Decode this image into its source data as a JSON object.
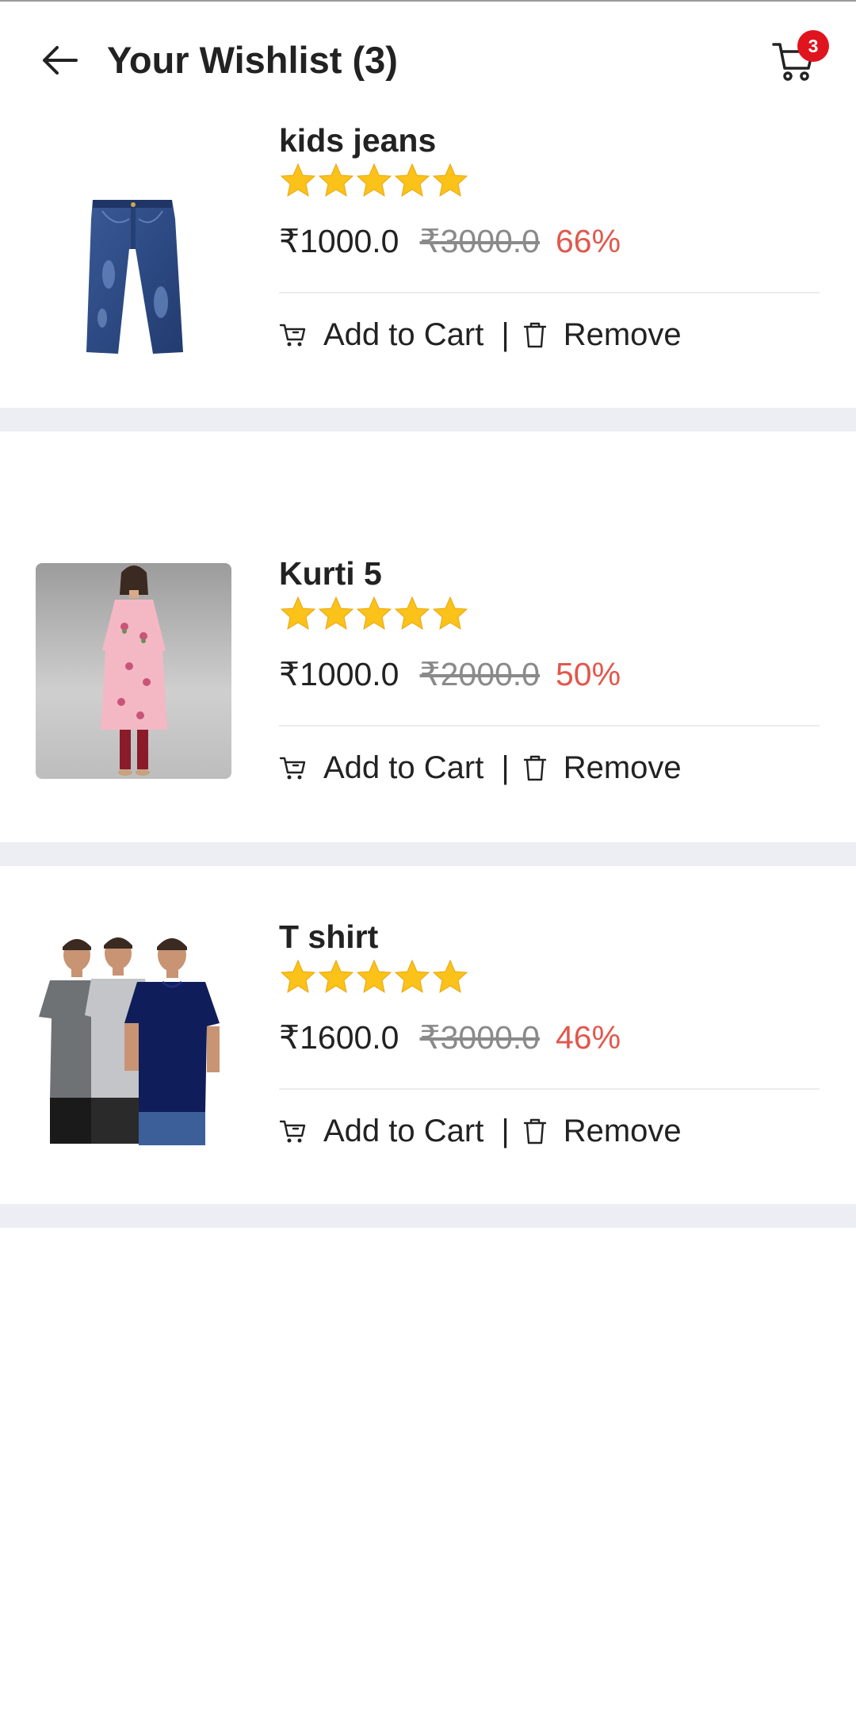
{
  "header": {
    "title": "Your Wishlist (3)",
    "back_icon": "arrow-left-icon",
    "cart_icon": "cart-icon",
    "cart_count": "3"
  },
  "colors": {
    "badge": "#e0141e",
    "discount": "#e2574c",
    "star": "#fbc21a",
    "divider": "#eceef3"
  },
  "items": [
    {
      "name": "kids jeans",
      "rating": 5,
      "price": "₹1000.0",
      "mrp": "₹3000.0",
      "discount": "66%",
      "add_to_cart": "Add to Cart",
      "separator": "|",
      "remove": "Remove",
      "image": "jeans"
    },
    {
      "name": "Kurti 5",
      "rating": 5,
      "price": "₹1000.0",
      "mrp": "₹2000.0",
      "discount": "50%",
      "add_to_cart": "Add to Cart",
      "separator": "|",
      "remove": "Remove",
      "image": "kurti"
    },
    {
      "name": "T shirt",
      "rating": 5,
      "price": "₹1600.0",
      "mrp": "₹3000.0",
      "discount": "46%",
      "add_to_cart": "Add to Cart",
      "separator": "|",
      "remove": "Remove",
      "image": "tshirts"
    }
  ]
}
